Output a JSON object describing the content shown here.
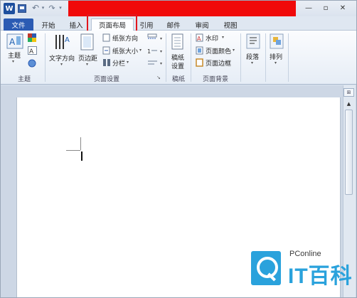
{
  "app": {
    "logo_letter": "W"
  },
  "quick_access": {
    "undo": "↶",
    "redo": "↷",
    "dropdown": "▾"
  },
  "window": {
    "minimize": "—",
    "maximize": "▫",
    "close": "✕"
  },
  "tabs": [
    {
      "label": "文件"
    },
    {
      "label": "开始"
    },
    {
      "label": "插入"
    },
    {
      "label": "页面布局",
      "active": true
    },
    {
      "label": "引用"
    },
    {
      "label": "邮件"
    },
    {
      "label": "审阅"
    },
    {
      "label": "视图"
    }
  ],
  "help": {
    "label": "?",
    "collapse": "⌃"
  },
  "ribbon": {
    "groups": {
      "theme": {
        "label": "主题",
        "theme_button": "主题"
      },
      "page_setup": {
        "label": "页面设置",
        "text_direction": "文字方向",
        "margins": "页边距",
        "orientation": "纸张方向",
        "size": "纸张大小",
        "columns": "分栏"
      },
      "manuscript": {
        "label": "稿纸",
        "manuscript_setup_line1": "稿纸",
        "manuscript_setup_line2": "设置"
      },
      "page_background": {
        "label": "页面背景",
        "watermark": "水印",
        "page_color": "页面颜色",
        "page_borders": "页面边框"
      },
      "paragraph": {
        "label": "段落"
      },
      "arrange": {
        "label": "排列"
      }
    }
  },
  "scrollbar": {
    "ruler_toggle": "⊞",
    "scroll_up": "▲"
  },
  "watermark_brand": {
    "name": "PConline",
    "text": "IT百科"
  },
  "colors": {
    "file_tab": "#2b5bb3",
    "redaction": "#f00a0a",
    "highlight_box": "#e2161d",
    "watermark_blue": "#2aa2dc"
  }
}
